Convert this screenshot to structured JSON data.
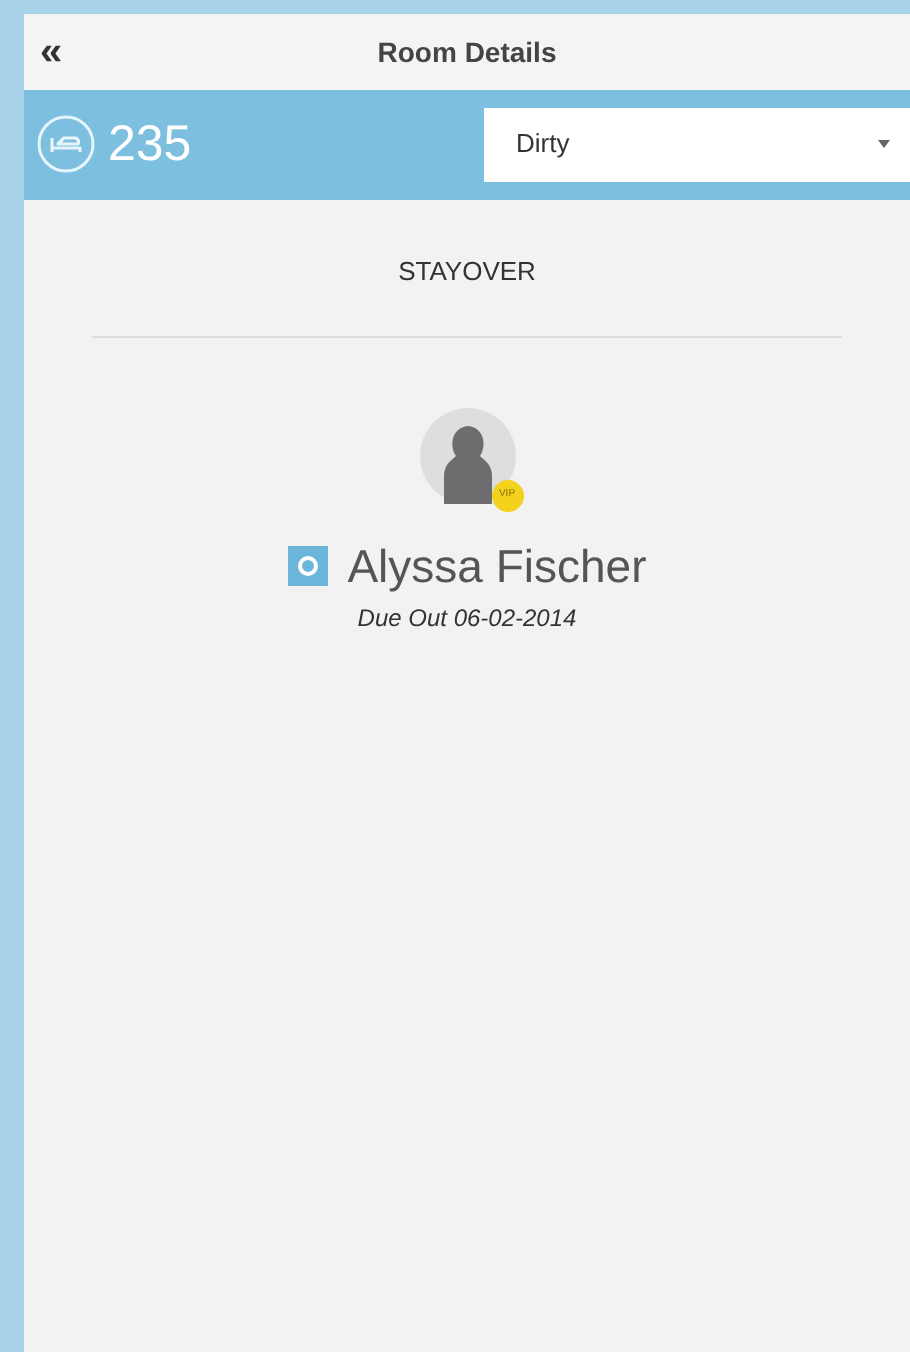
{
  "header": {
    "back": "«",
    "title": "Room Details"
  },
  "room": {
    "number": "235",
    "status": "Dirty"
  },
  "reservation_type": "STAYOVER",
  "guest": {
    "name": "Alyssa Fischer",
    "vip": true,
    "badge": "VIP",
    "due_out": "Due Out 06-02-2014"
  }
}
